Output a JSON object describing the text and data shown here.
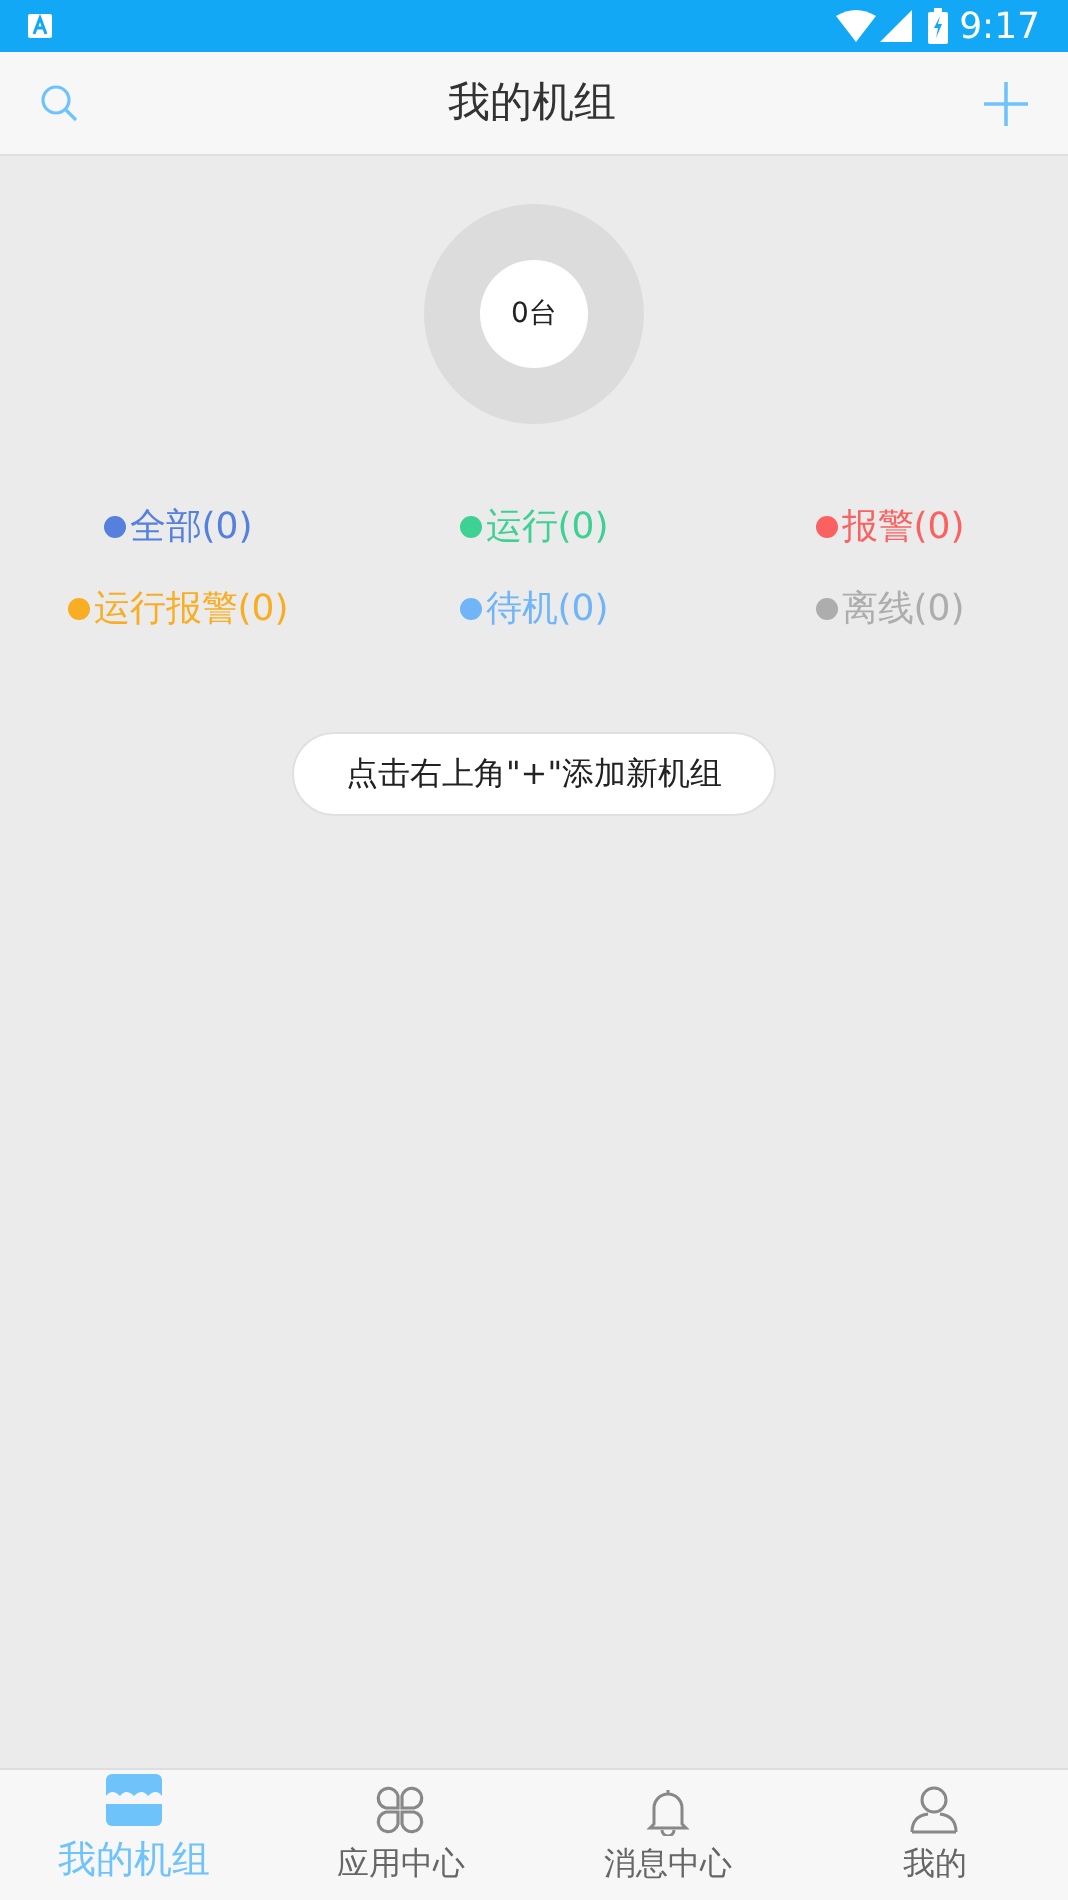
{
  "status_bar": {
    "time": "9:17"
  },
  "header": {
    "title": "我的机组"
  },
  "summary": {
    "count": "0台"
  },
  "filters": [
    {
      "label": "全部(0)",
      "color": "#5580de"
    },
    {
      "label": "运行(0)",
      "color": "#3dd193"
    },
    {
      "label": "报警(0)",
      "color": "#fb6160"
    },
    {
      "label": "运行报警(0)",
      "color": "#f9ad22"
    },
    {
      "label": "待机(0)",
      "color": "#6fb5f8"
    },
    {
      "label": "离线(0)",
      "color": "#adadad"
    }
  ],
  "hint": "点击右上角\"+\"添加新机组",
  "tabs": [
    {
      "label": "我的机组",
      "kind": "units",
      "selected": true
    },
    {
      "label": "应用中心",
      "kind": "apps",
      "selected": false
    },
    {
      "label": "消息中心",
      "kind": "messages",
      "selected": false
    },
    {
      "label": "我的",
      "kind": "profile",
      "selected": false
    }
  ]
}
